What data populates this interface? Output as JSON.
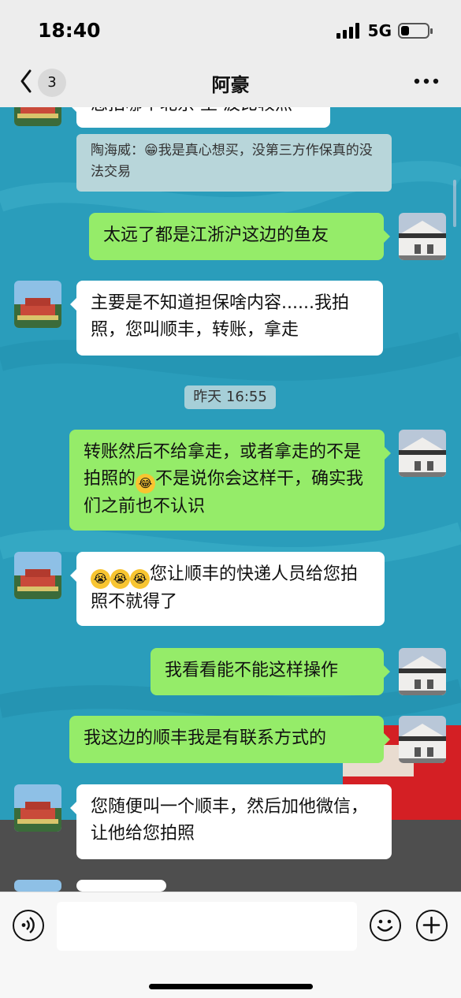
{
  "status": {
    "time": "18:40",
    "network": "5G",
    "battery_level": 0.3
  },
  "header": {
    "unread_count": "3",
    "title": "阿豪"
  },
  "messages": {
    "m0": "您拍哪个北京 至 波比较照",
    "quote": "陶海威：😁我是真心想买，没第三方作保真的没法交易",
    "m1": "太远了都是江浙沪这边的鱼友",
    "m2": "主要是不知道担保啥内容......我拍照，您叫顺丰，转账，拿走",
    "timestamp": "昨天 16:55",
    "m3_a": "转账然后不给拿走，或者拿走的不是拍照的",
    "m3_b": "不是说你会这样干，确实我们之前也不认识",
    "m4": "您让顺丰的快递人员给您拍照不就得了",
    "m5": "我看看能不能这样操作",
    "m6": "我这边的顺丰我是有联系方式的",
    "m7": "您随便叫一个顺丰，然后加他微信，让他给您拍照"
  },
  "icons": {
    "back": "chevron-left-icon",
    "more": "ellipsis-icon",
    "voice": "voice-icon",
    "emoji": "emoji-icon",
    "plus": "plus-icon"
  }
}
